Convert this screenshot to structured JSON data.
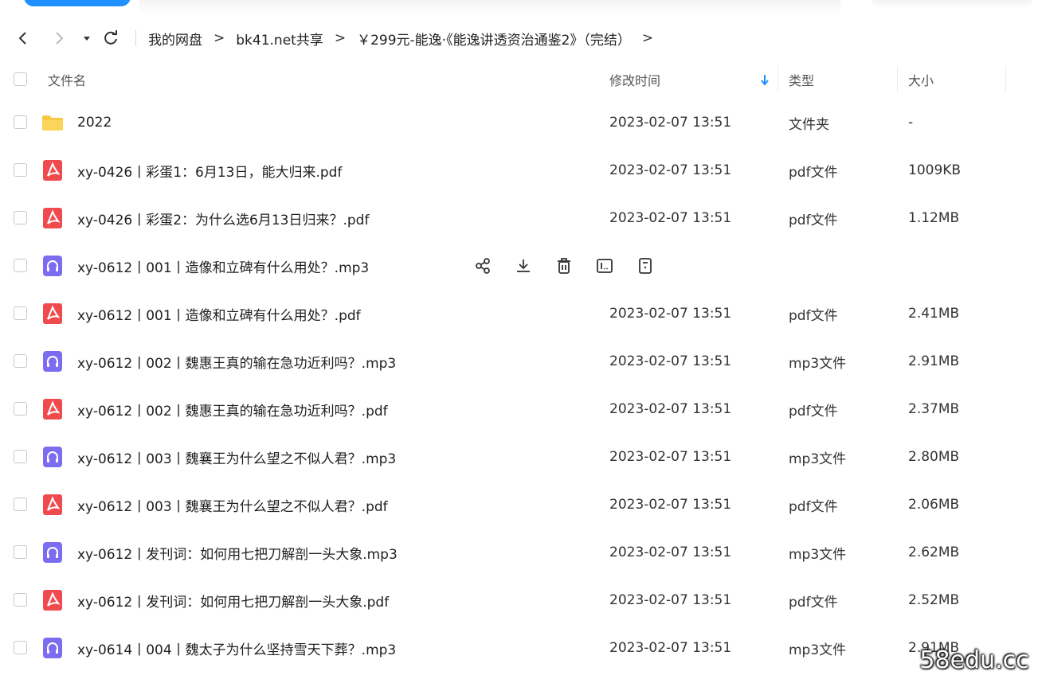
{
  "breadcrumb": {
    "items": [
      "我的网盘",
      "bk41.net共享",
      "￥299元-能逸·《能逸讲透资治通鉴2》（完结）"
    ],
    "separator": ">"
  },
  "columns": {
    "name": "文件名",
    "modified": "修改时间",
    "type": "类型",
    "size": "大小"
  },
  "colors": {
    "accent": "#1e90ff",
    "folder": "#f9c944",
    "pdf": "#ef4b4e",
    "audio": "#7c6cf0"
  },
  "files": [
    {
      "icon": "folder-icon",
      "name": "2022",
      "modified": "2023-02-07 13:51",
      "type": "文件夹",
      "size": "-"
    },
    {
      "icon": "pdf-icon",
      "name": "xy-0426丨彩蛋1：6月13日，能大归来.pdf",
      "modified": "2023-02-07 13:51",
      "type": "pdf文件",
      "size": "1009KB"
    },
    {
      "icon": "pdf-icon",
      "name": "xy-0426丨彩蛋2：为什么选6月13日归来？.pdf",
      "modified": "2023-02-07 13:51",
      "type": "pdf文件",
      "size": "1.12MB"
    },
    {
      "icon": "audio-icon",
      "name": "xy-0612丨001丨造像和立碑有什么用处？.mp3",
      "modified": "",
      "type": "",
      "size": "",
      "hovered": true
    },
    {
      "icon": "pdf-icon",
      "name": "xy-0612丨001丨造像和立碑有什么用处？.pdf",
      "modified": "2023-02-07 13:51",
      "type": "pdf文件",
      "size": "2.41MB"
    },
    {
      "icon": "audio-icon",
      "name": "xy-0612丨002丨魏惠王真的输在急功近利吗？.mp3",
      "modified": "2023-02-07 13:51",
      "type": "mp3文件",
      "size": "2.91MB"
    },
    {
      "icon": "pdf-icon",
      "name": "xy-0612丨002丨魏惠王真的输在急功近利吗？.pdf",
      "modified": "2023-02-07 13:51",
      "type": "pdf文件",
      "size": "2.37MB"
    },
    {
      "icon": "audio-icon",
      "name": "xy-0612丨003丨魏襄王为什么望之不似人君？.mp3",
      "modified": "2023-02-07 13:51",
      "type": "mp3文件",
      "size": "2.80MB"
    },
    {
      "icon": "pdf-icon",
      "name": "xy-0612丨003丨魏襄王为什么望之不似人君？.pdf",
      "modified": "2023-02-07 13:51",
      "type": "pdf文件",
      "size": "2.06MB"
    },
    {
      "icon": "audio-icon",
      "name": "xy-0612丨发刊词：如何用七把刀解剖一头大象.mp3",
      "modified": "2023-02-07 13:51",
      "type": "mp3文件",
      "size": "2.62MB"
    },
    {
      "icon": "pdf-icon",
      "name": "xy-0612丨发刊词：如何用七把刀解剖一头大象.pdf",
      "modified": "2023-02-07 13:51",
      "type": "pdf文件",
      "size": "2.52MB"
    },
    {
      "icon": "audio-icon",
      "name": "xy-0614丨004丨魏太子为什么坚持雪天下葬？.mp3",
      "modified": "2023-02-07 13:51",
      "type": "mp3文件",
      "size": "2.91MB"
    }
  ],
  "row_actions": [
    "share-icon",
    "download-icon",
    "delete-icon",
    "rename-icon",
    "more-icon"
  ],
  "watermark": "58edu.cc"
}
